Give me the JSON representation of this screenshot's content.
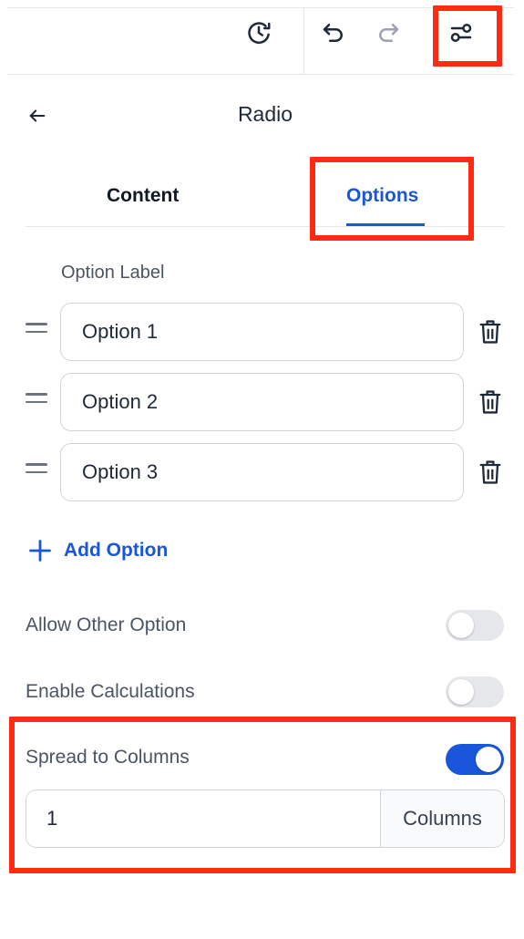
{
  "toolbar": {
    "history_icon": "history-clock-icon",
    "undo_icon": "undo-arrow-icon",
    "redo_icon": "redo-arrow-icon",
    "settings_icon": "sliders-toggle-icon"
  },
  "header": {
    "back_icon": "arrow-left-icon",
    "title": "Radio"
  },
  "tabs": [
    {
      "label": "Content",
      "active": false
    },
    {
      "label": "Options",
      "active": true
    }
  ],
  "options": {
    "column_label": "Option Label",
    "items": [
      {
        "value": "Option 1"
      },
      {
        "value": "Option 2"
      },
      {
        "value": "Option 3"
      }
    ],
    "add_label": "Add Option"
  },
  "settings": {
    "allow_other": {
      "label": "Allow Other Option",
      "on": false
    },
    "enable_calculations": {
      "label": "Enable Calculations",
      "on": false
    },
    "spread_to_columns": {
      "label": "Spread to Columns",
      "on": true
    },
    "columns": {
      "value": "1",
      "addon": "Columns"
    }
  },
  "colors": {
    "accent": "#1a56db",
    "highlight": "#ff2a12",
    "text": "#1f2937",
    "muted": "#4b5563"
  }
}
